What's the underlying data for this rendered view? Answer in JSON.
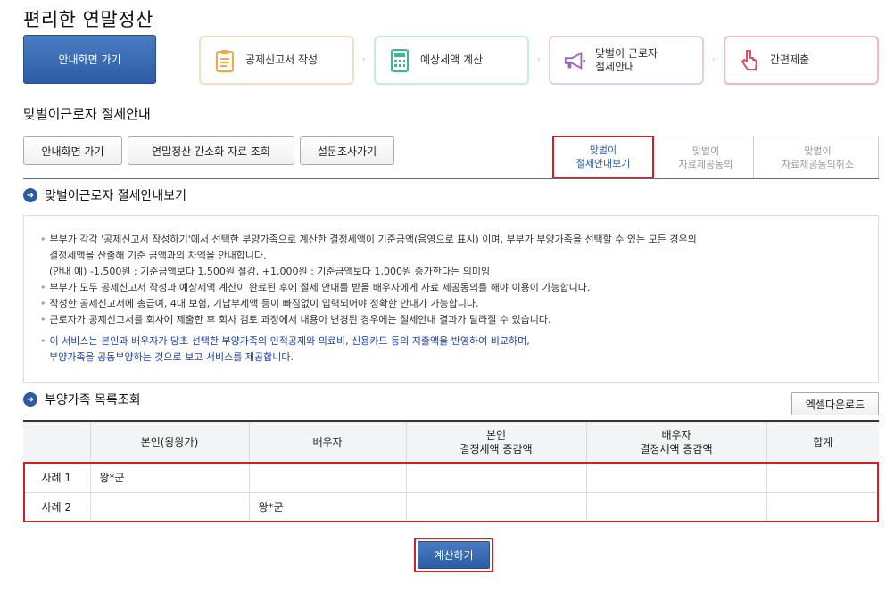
{
  "app": {
    "title": "편리한 연말정산"
  },
  "steps": {
    "home": "안내화면 가기",
    "items": [
      {
        "label": "공제신고서 작성",
        "icon": "clipboard-icon",
        "color": "#f0a848"
      },
      {
        "label": "예상세액 계산",
        "icon": "calculator-icon",
        "color": "#3cb88a"
      },
      {
        "label_line1": "맞벌이 근로자",
        "label_line2": "절세안내",
        "icon": "megaphone-icon",
        "color": "#a060c0"
      },
      {
        "label": "간편제출",
        "icon": "pointer-hand-icon",
        "color": "#e05060"
      }
    ]
  },
  "page": {
    "title": "맞벌이근로자 절세안내"
  },
  "toolbar": {
    "home": "안내화면 가기",
    "simplified": "연말정산 간소화 자료 조회",
    "survey": "설문조사가기"
  },
  "tabs": [
    {
      "line1": "맞벌이",
      "line2": "절세안내보기"
    },
    {
      "line1": "맞벌이",
      "line2": "자료제공동의"
    },
    {
      "line1": "맞벌이",
      "line2": "자료제공동의취소"
    }
  ],
  "section1": {
    "title": "맞벌이근로자 절세안내보기",
    "lines": [
      "부부가 각각 '공제신고서 작성하기'에서 선택한 부양가족으로 계산한 결정세액이 기준금액(음영으로 표시) 이며, 부부가 부양가족을 선택할 수 있는 모든 경우의",
      "결정세액을 산출해 기준 금액과의 차액을 안내합니다.",
      "(안내 예) -1,500원 : 기준금액보다 1,500원 절감, +1,000원 : 기준금액보다 1,000원 증가한다는 의미임",
      "부부가 모두 공제신고서 작성과 예상세액 계산이 완료된 후에 절세 안내를 받을 배우자에게 자료 제공동의를 해야 이용이 가능합니다.",
      "작성한 공제신고서에 총급여, 4대 보험, 기납부세액 등이 빠짐없이 입력되어야 정확한 안내가 가능합니다.",
      "근로자가 공제신고서를 회사에 제출한 후 회사 검토 과정에서 내용이 변경된 경우에는 절세안내 결과가 달라질 수 있습니다."
    ],
    "notice1": "이 서비스는 본인과 배우자가 당초 선택한 부양가족의 인적공제와 의료비, 신용카드 등의 지출액을 반영하여 비교하며,",
    "notice2": "부양가족을 공동부양하는 것으로 보고 서비스를 제공합니다."
  },
  "section2": {
    "title": "부양가족 목록조회",
    "excel": "엑셀다운로드",
    "headers": {
      "self": "본인(왕왕가)",
      "spouse": "배우자",
      "self_diff_1": "본인",
      "self_diff_2": "결정세액 증감액",
      "spouse_diff_1": "배우자",
      "spouse_diff_2": "결정세액 증감액",
      "total": "합계"
    },
    "rows": [
      {
        "case": "사례 1",
        "self": "왕*군",
        "spouse": "",
        "self_diff": "",
        "spouse_diff": "",
        "total": ""
      },
      {
        "case": "사례 2",
        "self": "",
        "spouse": "왕*군",
        "self_diff": "",
        "spouse_diff": "",
        "total": ""
      }
    ]
  },
  "actions": {
    "calculate": "계산하기"
  }
}
